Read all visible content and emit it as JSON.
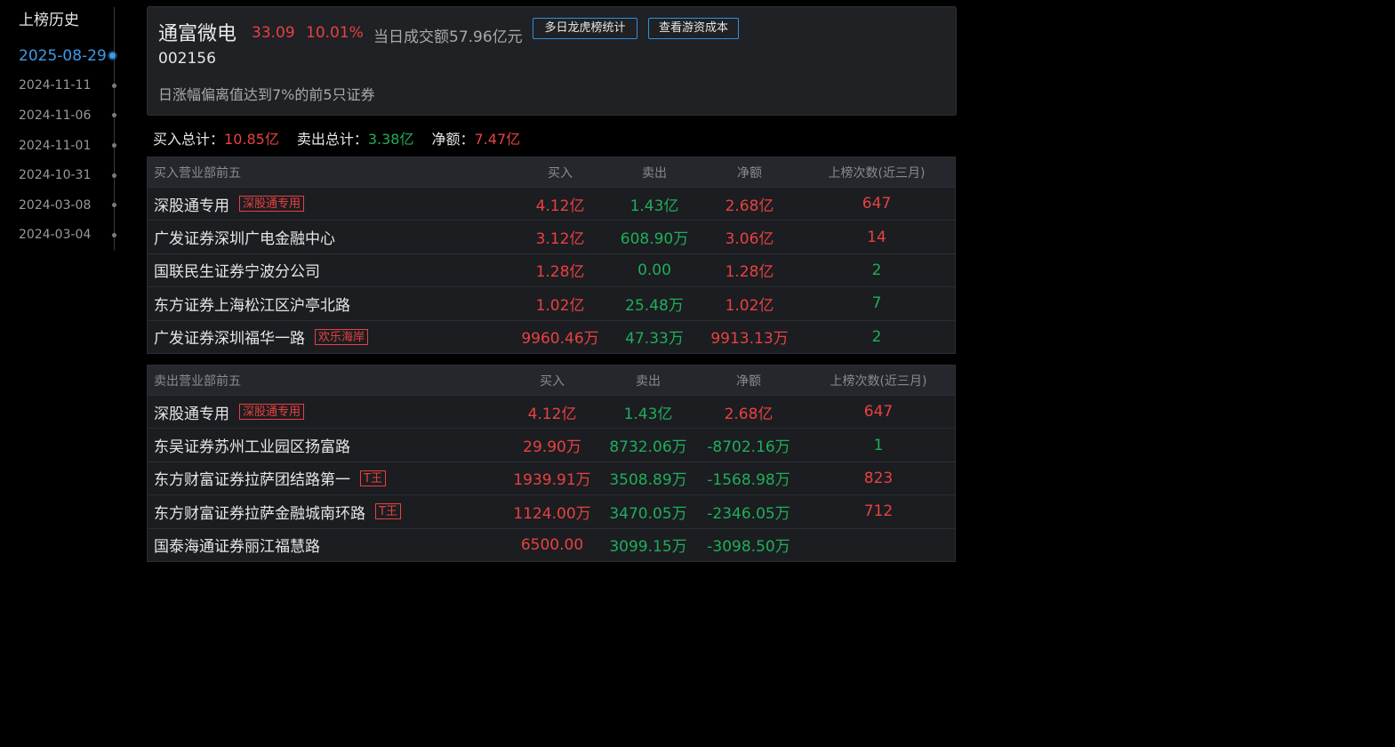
{
  "timeline": {
    "title": "上榜历史",
    "dates": [
      "2025-08-29",
      "2024-11-11",
      "2024-11-06",
      "2024-11-01",
      "2024-10-31",
      "2024-03-08",
      "2024-03-04"
    ],
    "active_index": 0
  },
  "stock": {
    "name": "通富微电",
    "price": "33.09",
    "change_pct": "10.01%",
    "turnover": "当日成交额57.96亿元",
    "code": "002156",
    "reason": "日涨幅偏离值达到7%的前5只证券",
    "btn_multi_day": "多日龙虎榜统计",
    "btn_cost": "查看游资成本"
  },
  "summary": {
    "buy_label": "买入总计：",
    "buy_value": "10.85亿",
    "sell_label": "卖出总计：",
    "sell_value": "3.38亿",
    "net_label": "净额：",
    "net_value": "7.47亿"
  },
  "colors": {
    "up": "#e84141",
    "down": "#1fae5a",
    "accent": "#3d9be9"
  },
  "buy_table": {
    "headers": [
      "买入营业部前五",
      "买入",
      "卖出",
      "净额",
      "上榜次数(近三月)"
    ],
    "rows": [
      {
        "name": "深股通专用",
        "tag": "深股通专用",
        "buy": "4.12亿",
        "sell": "1.43亿",
        "net": "2.68亿",
        "net_color": "red",
        "count": "647",
        "count_color": "red"
      },
      {
        "name": "广发证券深圳广电金融中心",
        "tag": "",
        "buy": "3.12亿",
        "sell": "608.90万",
        "net": "3.06亿",
        "net_color": "red",
        "count": "14",
        "count_color": "red"
      },
      {
        "name": "国联民生证券宁波分公司",
        "tag": "",
        "buy": "1.28亿",
        "sell": "0.00",
        "net": "1.28亿",
        "net_color": "red",
        "count": "2",
        "count_color": "green"
      },
      {
        "name": "东方证券上海松江区沪亭北路",
        "tag": "",
        "buy": "1.02亿",
        "sell": "25.48万",
        "net": "1.02亿",
        "net_color": "red",
        "count": "7",
        "count_color": "green"
      },
      {
        "name": "广发证券深圳福华一路",
        "tag": "欢乐海岸",
        "buy": "9960.46万",
        "sell": "47.33万",
        "net": "9913.13万",
        "net_color": "red",
        "count": "2",
        "count_color": "green"
      }
    ]
  },
  "sell_table": {
    "headers": [
      "卖出营业部前五",
      "买入",
      "卖出",
      "净额",
      "上榜次数(近三月)"
    ],
    "rows": [
      {
        "name": "深股通专用",
        "tag": "深股通专用",
        "buy": "4.12亿",
        "sell": "1.43亿",
        "net": "2.68亿",
        "net_color": "red",
        "count": "647",
        "count_color": "red"
      },
      {
        "name": "东吴证券苏州工业园区扬富路",
        "tag": "",
        "buy": "29.90万",
        "sell": "8732.06万",
        "net": "-8702.16万",
        "net_color": "green",
        "count": "1",
        "count_color": "green"
      },
      {
        "name": "东方财富证券拉萨团结路第一",
        "tag": "T王",
        "buy": "1939.91万",
        "sell": "3508.89万",
        "net": "-1568.98万",
        "net_color": "green",
        "count": "823",
        "count_color": "red"
      },
      {
        "name": "东方财富证券拉萨金融城南环路",
        "tag": "T王",
        "buy": "1124.00万",
        "sell": "3470.05万",
        "net": "-2346.05万",
        "net_color": "green",
        "count": "712",
        "count_color": "red"
      },
      {
        "name": "国泰海通证券丽江福慧路",
        "tag": "",
        "buy": "6500.00",
        "sell": "3099.15万",
        "net": "-3098.50万",
        "net_color": "green",
        "count": "",
        "count_color": "red"
      }
    ]
  }
}
